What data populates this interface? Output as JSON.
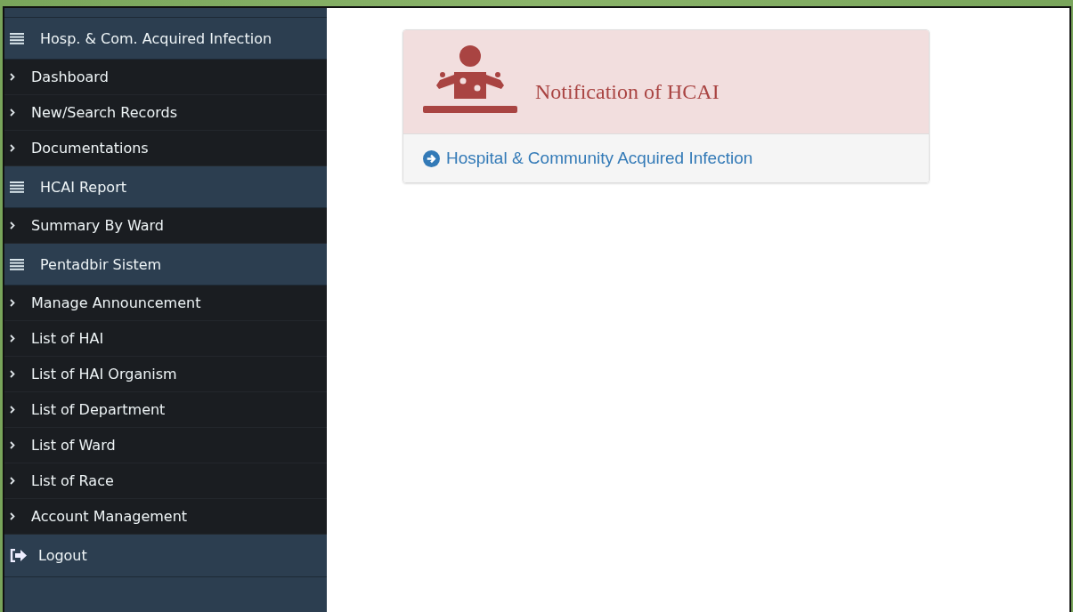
{
  "sidebar": {
    "sections": [
      {
        "kind": "header",
        "label": "Hosp. & Com. Acquired Infection",
        "items": [
          {
            "label": "Dashboard"
          },
          {
            "label": "New/Search Records"
          },
          {
            "label": "Documentations"
          }
        ]
      },
      {
        "kind": "header",
        "label": "HCAI Report",
        "items": [
          {
            "label": "Summary By Ward"
          }
        ]
      },
      {
        "kind": "header",
        "label": "Pentadbir Sistem",
        "items": [
          {
            "label": "Manage Announcement"
          },
          {
            "label": "List of HAI"
          },
          {
            "label": "List of HAI Organism"
          },
          {
            "label": "List of Department"
          },
          {
            "label": "List of Ward"
          },
          {
            "label": "List of Race"
          },
          {
            "label": "Account Management"
          }
        ]
      },
      {
        "kind": "logout",
        "label": "Logout"
      }
    ]
  },
  "card": {
    "title": "Notification of HCAI",
    "link": "Hospital & Community Acquired Infection"
  }
}
